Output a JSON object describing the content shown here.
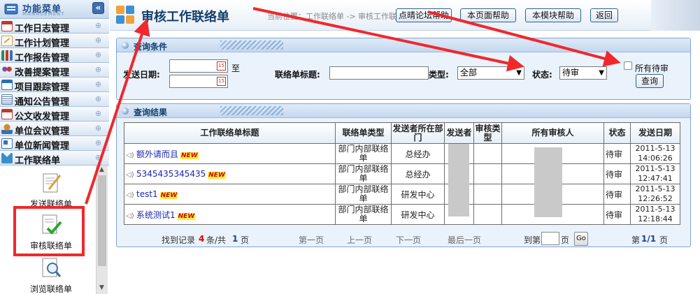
{
  "sidebar": {
    "title": "功能菜单",
    "subtitle": "MANAGEMENT",
    "collapse_icon": "«",
    "expand_icon": "⊕",
    "items": [
      {
        "label": "工作日志管理",
        "icon": "calendar-icon",
        "color": "#c0392b"
      },
      {
        "label": "工作计划管理",
        "icon": "pencil-note-icon",
        "color": "#d8a03a"
      },
      {
        "label": "工作报告管理",
        "icon": "bar-chart-icon",
        "color": "#2e8b57"
      },
      {
        "label": "改善提案管理",
        "icon": "people-icon",
        "color": "#7a4fa3"
      },
      {
        "label": "项目跟踪管理",
        "icon": "window-icon",
        "color": "#2d6fb3"
      },
      {
        "label": "通知公告管理",
        "icon": "document-icon",
        "color": "#5b7fa8"
      },
      {
        "label": "公文收发管理",
        "icon": "calendar-icon",
        "color": "#c0392b"
      },
      {
        "label": "单位会议管理",
        "icon": "meeting-icon",
        "color": "#d08a2e"
      },
      {
        "label": "单位新闻管理",
        "icon": "news-icon",
        "color": "#3d6fb0"
      },
      {
        "label": "工作联络单",
        "icon": "home-icon",
        "color": "#3a8fc6"
      }
    ],
    "sub_items": [
      {
        "label": "发送联络单",
        "icon": "write-icon"
      },
      {
        "label": "审核联络单",
        "icon": "approve-icon"
      },
      {
        "label": "浏览联络单",
        "icon": "browse-icon"
      }
    ]
  },
  "header": {
    "title": "审核工作联络单",
    "breadcrumb": "当前位置：工作联络单   ->   审核工作联络单",
    "buttons": [
      "点晴论坛帮助",
      "本页面帮助",
      "本模块帮助",
      "返回"
    ]
  },
  "query": {
    "panel_title": "查询条件",
    "date_label": "发送日期:",
    "to_label": "至",
    "subject_label": "联络单标题:",
    "type_label": "类型:",
    "type_value": "全部",
    "status_label": "状态:",
    "status_value": "待审",
    "pending_label": "所有待审",
    "search_button": "查询"
  },
  "results": {
    "panel_title": "查询结果",
    "columns": [
      "工作联络单标题",
      "联络单类型",
      "发送者所在部门",
      "发送者",
      "审核类型",
      "所有审核人",
      "状态",
      "发送日期"
    ],
    "new_badge": "NEW",
    "rows": [
      {
        "title": "额外请而且",
        "type": "部门内部联络单",
        "dept": "总经办",
        "status": "待审",
        "date": "2011-5-13",
        "time": "14:06:26"
      },
      {
        "title": "5345435345435",
        "type": "部门内部联络单",
        "dept": "总经办",
        "status": "待审",
        "date": "2011-5-13",
        "time": "12:47:41"
      },
      {
        "title": "test1",
        "type": "部门内部联络单",
        "dept": "研发中心",
        "status": "待审",
        "date": "2011-5-13",
        "time": "12:26:52"
      },
      {
        "title": "系统测试1",
        "type": "部门内部联络单",
        "dept": "研发中心",
        "status": "待审",
        "date": "2011-5-13",
        "time": "12:18:44"
      }
    ]
  },
  "pager": {
    "found_prefix": "找到记录",
    "record_count": "4",
    "found_middle": "条/共",
    "page_total": "1",
    "found_suffix": "页",
    "first": "第一页",
    "prev": "上一页",
    "next": "下一页",
    "last": "最后一页",
    "goto_prefix": "到第",
    "goto_suffix": "页",
    "go_button": "Go",
    "page_prefix": "第",
    "current_page": "1/1",
    "page_suffix": "页"
  },
  "annotation": {
    "color": "#f0282c"
  }
}
